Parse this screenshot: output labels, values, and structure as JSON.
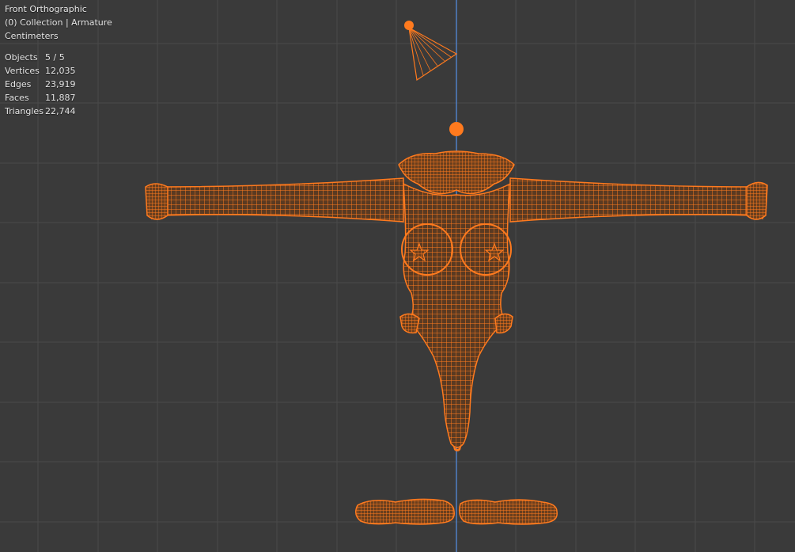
{
  "viewport": {
    "view_name": "Front Orthographic",
    "collection_info": "(0) Collection | Armature",
    "units": "Centimeters"
  },
  "stats": [
    {
      "label": "Objects",
      "value": "5 / 5"
    },
    {
      "label": "Vertices",
      "value": "12,035"
    },
    {
      "label": "Edges",
      "value": "23,919"
    },
    {
      "label": "Faces",
      "value": "11,887"
    },
    {
      "label": "Triangles",
      "value": "22,744"
    }
  ],
  "colors": {
    "background": "#3a3a3a",
    "grid": "#4a4a4a",
    "axis": "#4f7fc4",
    "wire": "#ff7a1e",
    "wire_dark": "#c85310"
  }
}
